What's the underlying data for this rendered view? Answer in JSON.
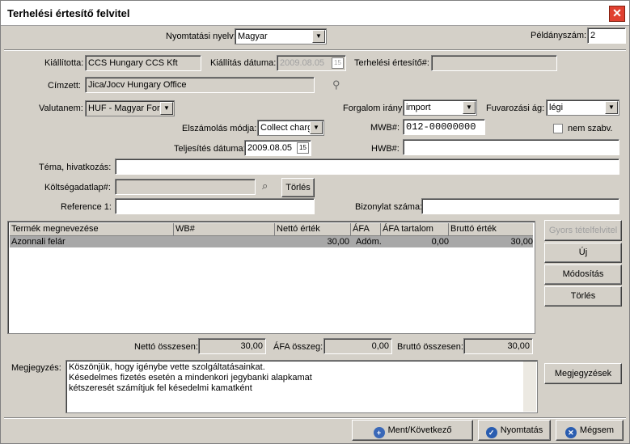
{
  "window": {
    "title": "Terhelési értesítő felvitel",
    "close_glyph": "✕"
  },
  "header": {
    "print_lang_label": "Nyomtatási nyelv:",
    "print_lang_value": "Magyar",
    "copies_label": "Példányszám:",
    "copies_value": "2"
  },
  "form": {
    "issuer_label": "Kiállította:",
    "issuer_value": "CCS Hungary CCS Kft",
    "issue_date_label": "Kiállítás dátuma:",
    "issue_date_value": "2009.08.05",
    "notice_no_label": "Terhelési értesítő#:",
    "notice_no_value": "",
    "addressee_label": "Címzett:",
    "addressee_value": "Jica/Jocv Hungary Office",
    "currency_label": "Valutanem:",
    "currency_value": "HUF - Magyar Forint",
    "traffic_label": "Forgalom irány:",
    "traffic_value": "import",
    "transport_label": "Fuvarozási ág:",
    "transport_value": "légi",
    "billing_label": "Elszámolás módja:",
    "billing_value": "Collect charge",
    "mwb_label": "MWB#:",
    "mwb_value": "012-00000000",
    "nonstd_label": "nem szabv.",
    "completion_label": "Teljesítés dátuma:",
    "completion_value": "2009.08.05",
    "hwb_label": "HWB#:",
    "hwb_value": "",
    "subject_label": "Téma, hivatkozás:",
    "subject_value": "",
    "costsheet_label": "Költségadatlap#:",
    "costsheet_value": "",
    "costsheet_delete": "Törlés",
    "ref_label": "Reference 1:",
    "ref_value": "",
    "doc_no_label": "Bizonylat száma:",
    "doc_no_value": "",
    "calendar_glyph": "15"
  },
  "table": {
    "columns": [
      "Termék megnevezése",
      "WB#",
      "Nettó érték",
      "ÁFA",
      "ÁFA tartalom",
      "Bruttó érték"
    ],
    "rows": [
      {
        "name": "Azonnali felár",
        "wb": "",
        "net": "30,00",
        "vat": "Adóm.",
        "vat_amount": "0,00",
        "gross": "30,00"
      }
    ]
  },
  "side_buttons": {
    "quick": "Gyors tételfelvitel",
    "new": "Új",
    "modify": "Módosítás",
    "delete": "Törlés",
    "notes": "Megjegyzések"
  },
  "totals": {
    "net_label": "Nettó összesen:",
    "net_value": "30,00",
    "vat_label": "ÁFA összeg:",
    "vat_value": "0,00",
    "gross_label": "Bruttó összesen:",
    "gross_value": "30,00"
  },
  "notes": {
    "label": "Megjegyzés:",
    "lines": [
      "Köszönjük, hogy igénybe vette szolgáltatásainkat.",
      "Késedelmes fizetés esetén a mindenkori jegybanki alapkamat",
      "kétszeresét számítjuk fel késedelmi kamatként"
    ]
  },
  "footer": {
    "save_next": "Ment/Következő",
    "print": "Nyomtatás",
    "cancel": "Mégsem"
  },
  "icons": {
    "close": "close-icon",
    "calendar": "calendar-icon",
    "person": "person-icon",
    "search": "search-icon",
    "add": "add-icon",
    "print": "check-icon",
    "cancel": "cancel-icon"
  }
}
